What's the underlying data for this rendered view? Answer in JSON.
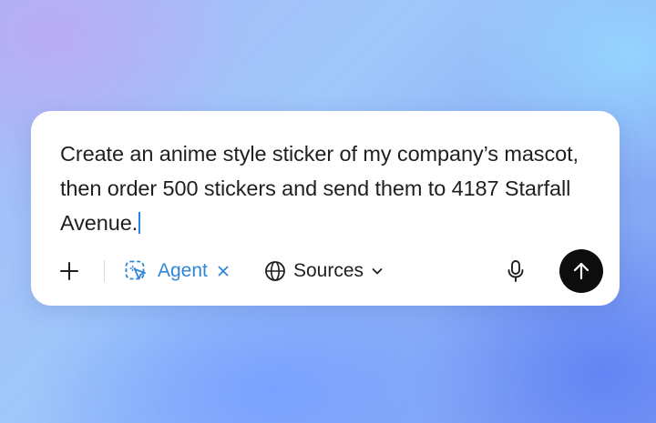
{
  "composer": {
    "prompt_text": "Create an anime style sticker of my company’s mascot, then order 500 stickers and send them to 4187 Starfall Avenue.",
    "toolbar": {
      "add_icon": "plus-icon",
      "agent": {
        "label": "Agent",
        "icon": "agent-cursor-icon",
        "remove_icon": "close-icon",
        "color": "#2f86d9"
      },
      "sources": {
        "label": "Sources",
        "icon": "globe-icon",
        "dropdown_icon": "chevron-down-icon"
      },
      "mic_icon": "microphone-icon",
      "send_icon": "arrow-up-icon"
    }
  }
}
